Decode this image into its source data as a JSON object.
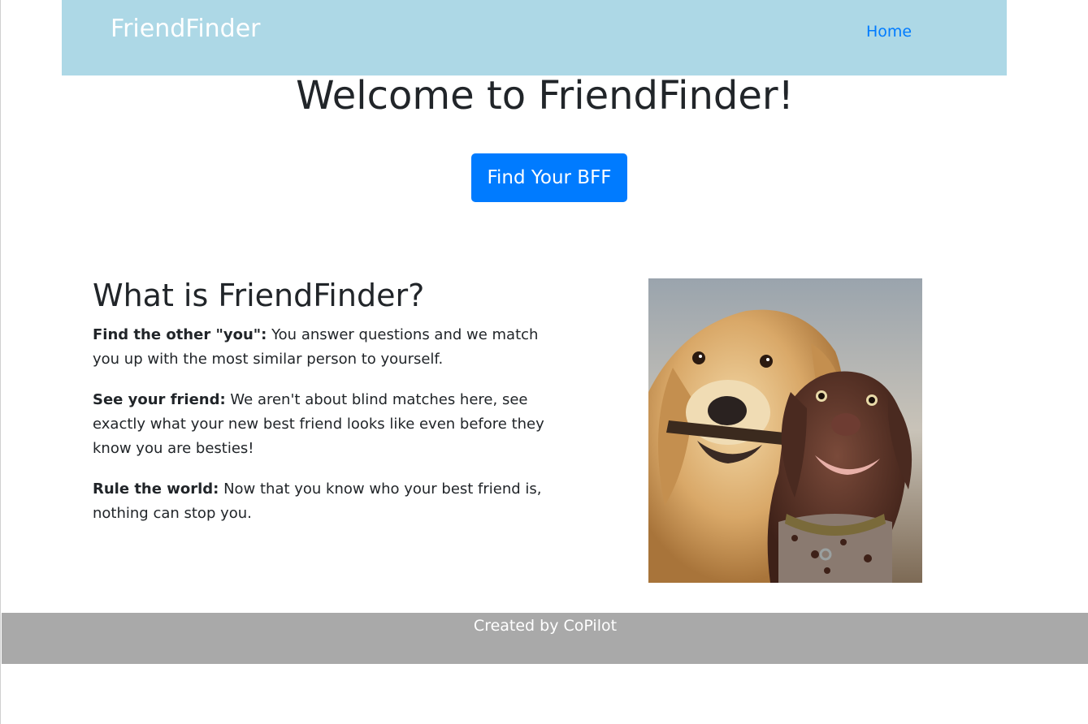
{
  "navbar": {
    "brand": "FriendFinder",
    "home_link": "Home"
  },
  "hero": {
    "title": "Welcome to FriendFinder!",
    "button_label": "Find Your BFF"
  },
  "about": {
    "heading": "What is FriendFinder?",
    "items": [
      {
        "label": "Find the other \"you\":",
        "text": " You answer questions and we match you up with the most similar person to yourself."
      },
      {
        "label": "See your friend:",
        "text": " We aren't about blind matches here, see exactly what your new best friend looks like even before they know you are besties!"
      },
      {
        "label": "Rule the world:",
        "text": " Now that you know who your best friend is, nothing can stop you."
      }
    ]
  },
  "footer": {
    "text": "Created by CoPilot"
  },
  "colors": {
    "navbar_bg": "#add8e6",
    "button_bg": "#007bff",
    "footer_bg": "#a9a9a9"
  }
}
